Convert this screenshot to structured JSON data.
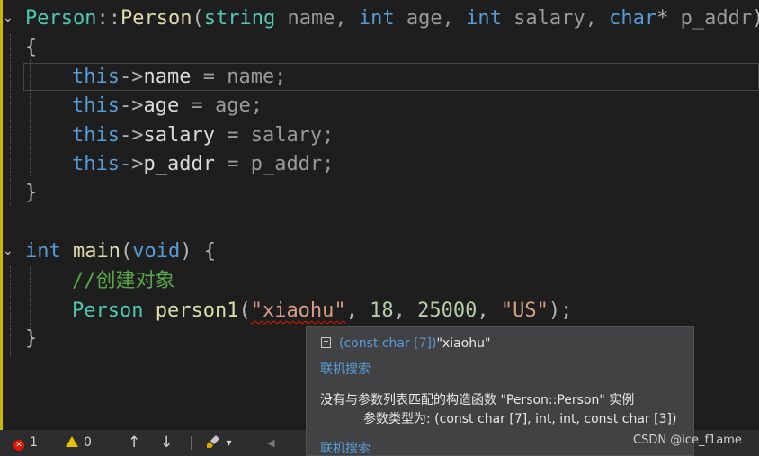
{
  "colors": {
    "background": "#1e1e1e",
    "keyword": "#569cd6",
    "type": "#4ec9b0",
    "function": "#dcdcaa",
    "string": "#d69d85",
    "number": "#b5cea8",
    "comment": "#57a64a",
    "error": "#e51400",
    "warning": "#e8c000"
  },
  "code": {
    "ctor_class": "Person",
    "ctor_scope": "::",
    "ctor_name": "Person",
    "ctor_open": "(",
    "ctor_t1": "string",
    "ctor_p1": " name, ",
    "ctor_t2": "int",
    "ctor_p2": " age, ",
    "ctor_t3": "int",
    "ctor_p3": " salary, ",
    "ctor_t4": "char",
    "ctor_star": "* ",
    "ctor_p4": "p_addr",
    "ctor_close": ")",
    "open_brace": "{",
    "close_brace": "}",
    "this_kw": "this",
    "arrow": "->",
    "m1": "name",
    "m1_rhs": " = name;",
    "m2": "age",
    "m2_rhs": " = age;",
    "m3": "salary",
    "m3_rhs": " = salary;",
    "m4": "p_addr",
    "m4_rhs": " = p_addr;",
    "main_int": "int",
    "main_name": " main",
    "main_open": "(",
    "main_void": "void",
    "main_close": ") {",
    "comment": "//创建对象",
    "decl_type": "Person",
    "decl_var": " person1",
    "decl_open": "(",
    "decl_str1": "\"xiaohu\"",
    "decl_sep1": ", ",
    "decl_n1": "18",
    "decl_sep2": ", ",
    "decl_n2": "25000",
    "decl_sep3": ", ",
    "decl_str2": "\"US\"",
    "decl_end": ");"
  },
  "tooltip": {
    "type_prefix": "(const char [7])",
    "type_value": "\"xiaohu\"",
    "search_link_1": "联机搜索",
    "error_message": "没有与参数列表匹配的构造函数 \"Person::Person\" 实例",
    "arg_types": "参数类型为: (const char [7], int, int, const char [3])",
    "search_link_2": "联机搜索"
  },
  "statusbar": {
    "error_count": "1",
    "warning_count": "0",
    "up_arrow": "↑",
    "down_arrow": "↓",
    "brush_icon": "brush-icon",
    "dropdown_arrow": "▾",
    "left_arrow": "◀"
  },
  "watermark": "CSDN @ice_f1ame"
}
